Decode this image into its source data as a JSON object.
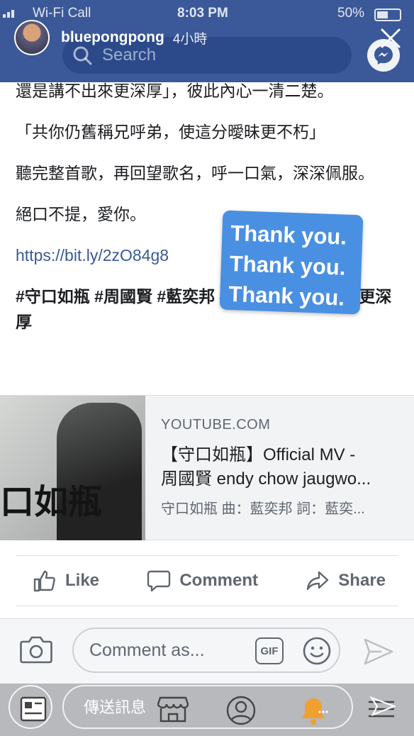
{
  "status_bar": {
    "carrier": "Wi-Fi Call",
    "time": "8:03 PM",
    "battery": "50%"
  },
  "header": {
    "search_placeholder": "Search"
  },
  "story": {
    "username": "bluepongpong",
    "time_ago": "4小時"
  },
  "post": {
    "paragraphs": [
      "還是講不出來更深厚」，彼此內心一清二楚。",
      "「共你仍舊稱兄呼弟，使這分曖昧更不朽」",
      "聽完整首歌，再回望歌名，呼一口氣，深深佩服。",
      "絕口不提，愛你。"
    ],
    "link": "https://bit.ly/2zO84g8",
    "hashtags": "#守口如瓶 #周國賢 #藍奕邦 #情懷還是講不出來更深厚"
  },
  "sticker": {
    "lines": [
      "Thank you.",
      "Thank you.",
      "Thank you."
    ]
  },
  "link_preview": {
    "image_caption": "口如瓶",
    "domain": "YOUTUBE.COM",
    "title_line1": "【守口如瓶】Official MV -",
    "title_line2": "周國賢 endy chow jaugwo...",
    "description": "守口如瓶 曲：藍奕邦 詞：藍奕..."
  },
  "actions": {
    "like": "Like",
    "comment": "Comment",
    "share": "Share"
  },
  "composer": {
    "placeholder": "Comment as...",
    "gif": "GIF"
  },
  "story_reply": {
    "placeholder": "傳送訊息"
  },
  "icons": {
    "camera": "camera-icon",
    "smiley": "smiley-icon",
    "send": "send-icon",
    "like": "thumbs-up-icon",
    "comment": "speech-bubble-icon",
    "share": "share-arrow-icon",
    "marketplace": "store-icon",
    "profile": "profile-icon",
    "notifications": "bell-icon",
    "menu": "menu-icon",
    "messenger": "messenger-icon",
    "search": "search-icon",
    "close": "close-icon"
  },
  "colors": {
    "facebook_blue": "#3b5998",
    "sticker_blue": "#4a90e2",
    "link_blue": "#3b5998",
    "muted_text": "#606770",
    "bell_orange": "#f0a030"
  }
}
